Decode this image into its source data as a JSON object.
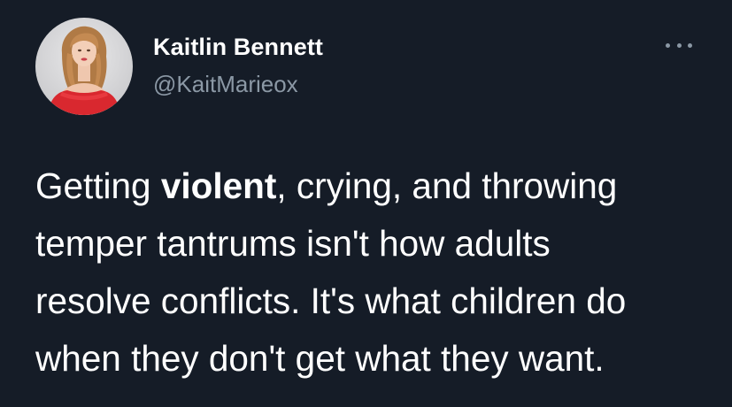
{
  "author": {
    "display_name": "Kaitlin Bennett",
    "handle": "@KaitMarieox",
    "avatar_icon": "profile-photo"
  },
  "more_icon": "more-horizontal-icon",
  "tweet": {
    "lines": [
      {
        "pre": "Getting ",
        "bold": "violent",
        "post": ", crying, and throwing"
      },
      {
        "text": "temper tantrums isn't how adults"
      },
      {
        "text": "resolve conflicts. It's what children do"
      },
      {
        "text": "when they don't get what they want."
      }
    ]
  },
  "colors": {
    "background": "#151c27",
    "text": "#ffffff",
    "secondary_text": "#8b98a5"
  }
}
